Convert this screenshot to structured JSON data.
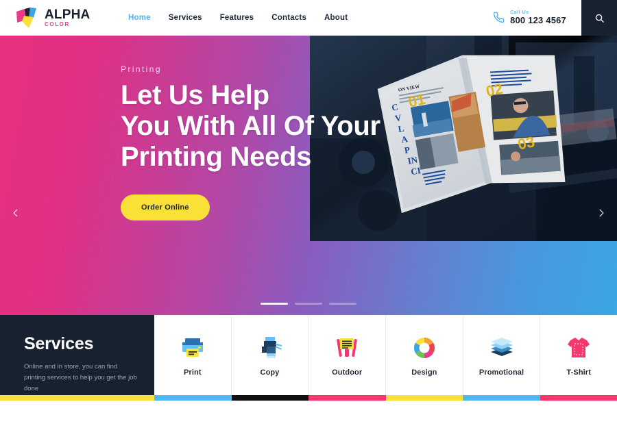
{
  "header": {
    "logo": {
      "title": "ALPHA",
      "subtitle": "COLOR",
      "icon": "alpha-color-logo-icon"
    },
    "nav": [
      {
        "label": "Home",
        "active": true
      },
      {
        "label": "Services",
        "active": false
      },
      {
        "label": "Features",
        "active": false
      },
      {
        "label": "Contacts",
        "active": false
      },
      {
        "label": "About",
        "active": false
      }
    ],
    "call": {
      "label": "Call Us",
      "number": "800 123 4567",
      "icon": "phone-icon"
    },
    "search": {
      "icon": "search-icon"
    }
  },
  "hero": {
    "eyebrow": "Printing",
    "title_line1": "Let Us Help",
    "title_line2": "You With All Of Your",
    "title_line3": "Printing Needs",
    "cta_label": "Order Online",
    "prev_icon": "chevron-left-icon",
    "next_icon": "chevron-right-icon",
    "slides": 3,
    "active_slide": 1,
    "image": {
      "alt": "open magazine spread on a printing press",
      "callout_numbers": [
        "01",
        "02",
        "03"
      ],
      "page_heading": "ON VIEW"
    },
    "gradient_from": "#e8317f",
    "gradient_to": "#3aa6e3"
  },
  "services": {
    "title": "Services",
    "description": "Online and in store, you can find printing services to help you get the job done",
    "accent_bar": "#fae137",
    "cards": [
      {
        "label": "Print",
        "icon": "printer-icon",
        "bar": "#4fb9f0"
      },
      {
        "label": "Copy",
        "icon": "copier-icon",
        "bar": "#111111"
      },
      {
        "label": "Outdoor",
        "icon": "easel-sign-icon",
        "bar": "#f7356f"
      },
      {
        "label": "Design",
        "icon": "color-ring-icon",
        "bar": "#fae137"
      },
      {
        "label": "Promotional",
        "icon": "paper-stack-icon",
        "bar": "#4fb9f0"
      },
      {
        "label": "T-Shirt",
        "icon": "tshirt-icon",
        "bar": "#f7356f"
      }
    ]
  }
}
